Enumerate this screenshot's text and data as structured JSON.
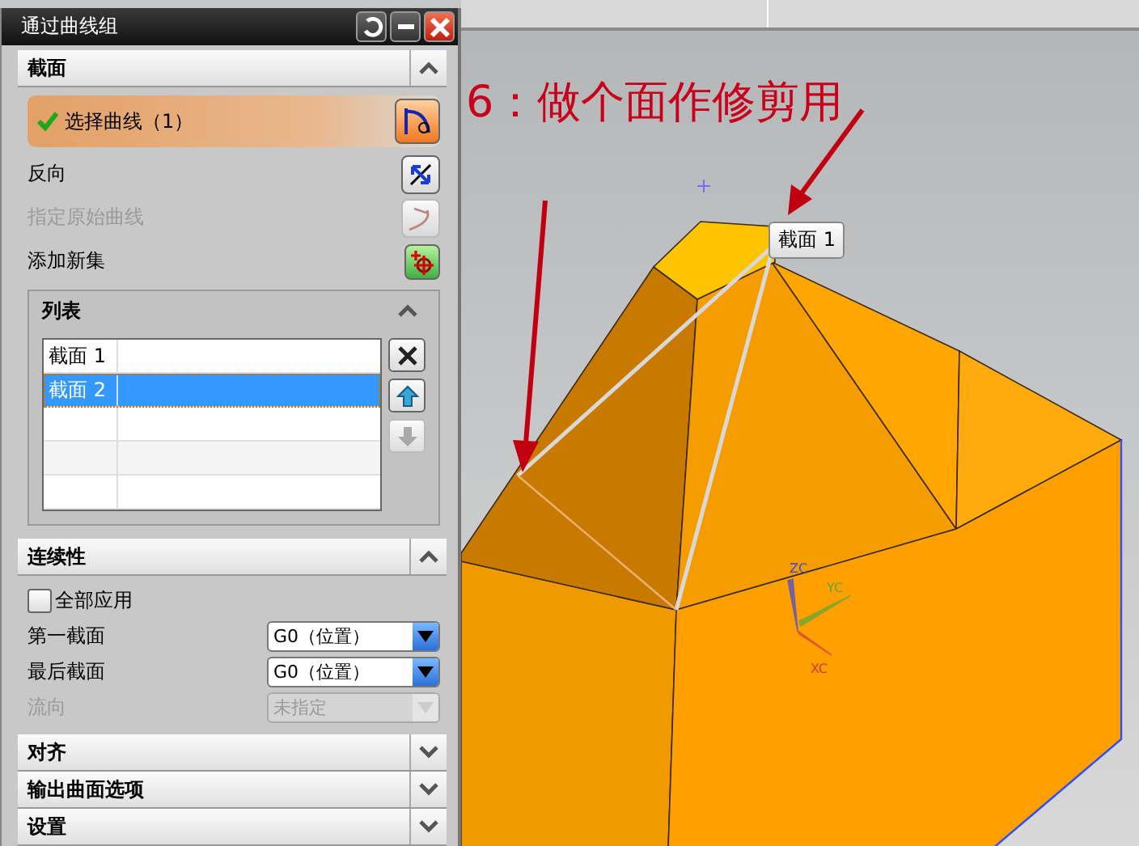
{
  "dialog": {
    "title": "通过曲线组",
    "section": {
      "title": "截面",
      "expanded": true,
      "rows": [
        {
          "kind": "select",
          "label": "选择曲线（1）",
          "done": true,
          "disabled": false
        },
        {
          "kind": "action",
          "label": "反向",
          "disabled": false
        },
        {
          "kind": "action",
          "label": "指定原始曲线",
          "disabled": true
        },
        {
          "kind": "action",
          "label": "添加新集",
          "disabled": false
        }
      ],
      "list": {
        "title": "列表",
        "expanded": true,
        "items": [
          {
            "label": "截面 1",
            "selected": false
          },
          {
            "label": "截面 2",
            "selected": true
          }
        ],
        "buttons": [
          {
            "kind": "delete",
            "disabled": false
          },
          {
            "kind": "up",
            "disabled": false
          },
          {
            "kind": "down",
            "disabled": true
          }
        ]
      }
    },
    "continuity": {
      "title": "连续性",
      "expanded": true,
      "apply_all": {
        "label": "全部应用",
        "checked": false
      },
      "fields": [
        {
          "label": "第一截面",
          "value": "G0（位置）",
          "disabled": false
        },
        {
          "label": "最后截面",
          "value": "G0（位置）",
          "disabled": false
        },
        {
          "label": "流向",
          "value": "未指定",
          "disabled": true
        }
      ]
    },
    "collapsed_sections": [
      {
        "title": "对齐",
        "expanded": false
      },
      {
        "title": "输出曲面选项",
        "expanded": false
      },
      {
        "title": "设置",
        "expanded": false
      }
    ]
  },
  "viewport": {
    "annotation": "6：做个面作修剪用",
    "tooltip": "截面 1",
    "axes": [
      {
        "label": "ZC",
        "color": "#3b48e0"
      },
      {
        "label": "YC",
        "color": "#5aa838"
      },
      {
        "label": "XC",
        "color": "#d23a3a"
      }
    ]
  }
}
